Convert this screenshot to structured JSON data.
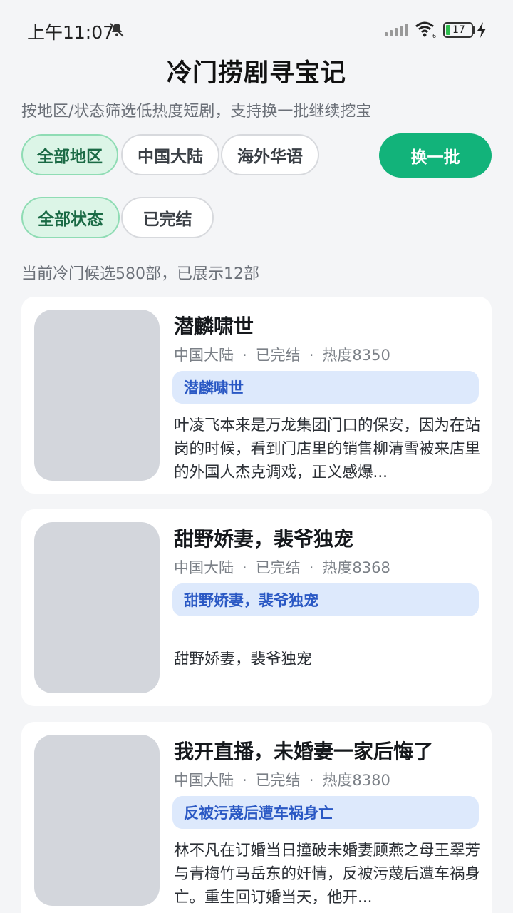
{
  "status_bar": {
    "time": "上午11:07",
    "battery": "17"
  },
  "header": {
    "title": "冷门捞剧寻宝记",
    "subtitle": "按地区/状态筛选低热度短剧，支持换一批继续挖宝"
  },
  "filters": {
    "region": [
      "全部地区",
      "中国大陆",
      "海外华语"
    ],
    "region_selected": "全部地区",
    "status": [
      "全部状态",
      "已完结"
    ],
    "status_selected": "全部状态",
    "refresh_label": "换一批"
  },
  "summary": "当前冷门候选580部，已展示12部",
  "colors": {
    "accent": "#12b37a",
    "chip_active_bg": "#dcf5e7",
    "tag_bg": "#dde9fc",
    "tag_text": "#2a58c4"
  },
  "dramas": [
    {
      "title": "潜麟啸世",
      "region": "中国大陆",
      "status": "已完结",
      "heat": "热度8350",
      "tag": "潜麟啸世",
      "desc": "叶凌飞本来是万龙集团门口的保安，因为在站岗的时候，看到门店里的销售柳清雪被来店里的外国人杰克调戏，正义感爆..."
    },
    {
      "title": "甜野娇妻，裴爷独宠",
      "region": "中国大陆",
      "status": "已完结",
      "heat": "热度8368",
      "tag": "甜野娇妻，裴爷独宠",
      "desc": "甜野娇妻，裴爷独宠"
    },
    {
      "title": "我开直播，未婚妻一家后悔了",
      "region": "中国大陆",
      "status": "已完结",
      "heat": "热度8380",
      "tag": "反被污蔑后遭车祸身亡",
      "desc": "林不凡在订婚当日撞破未婚妻顾燕之母王翠芳与青梅竹马岳东的奸情，反被污蔑后遭车祸身亡。重生回订婚当天，他开..."
    }
  ]
}
